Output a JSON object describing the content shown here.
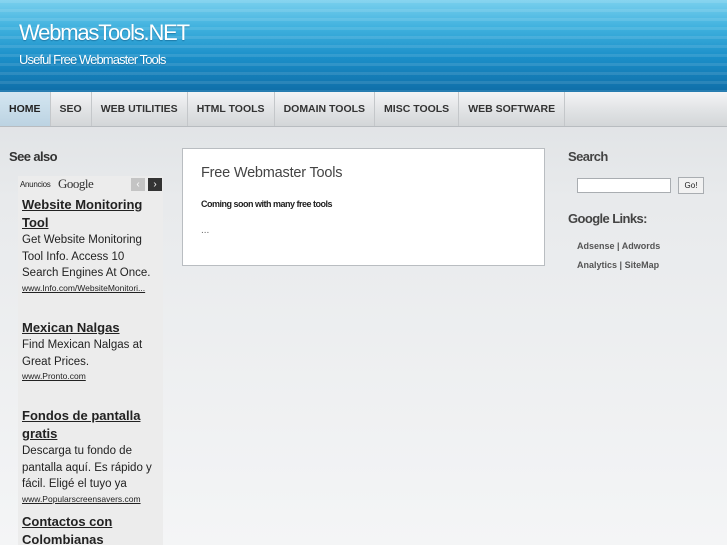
{
  "header": {
    "title": "WebmasTools.NET",
    "tagline": "Useful Free Webmaster Tools"
  },
  "nav": {
    "items": [
      {
        "label": "HOME"
      },
      {
        "label": "SEO"
      },
      {
        "label": "WEB UTILITIES"
      },
      {
        "label": "HTML TOOLS"
      },
      {
        "label": "DOMAIN TOOLS"
      },
      {
        "label": "MISC TOOLS"
      },
      {
        "label": "WEB SOFTWARE"
      }
    ],
    "active": "HOME"
  },
  "left": {
    "heading": "See also",
    "ads": {
      "anuncios_label": "Anuncios",
      "google_label": "Google",
      "prev_icon": "‹",
      "next_icon": "›",
      "items": [
        {
          "title": "Website Monitoring Tool",
          "desc": "Get Website Monitoring Tool Info. Access 10 Search Engines At Once.",
          "url": "www.Info.com/WebsiteMonitori..."
        },
        {
          "title": "Mexican Nalgas",
          "desc": "Find Mexican Nalgas at Great Prices.",
          "url": "www.Pronto.com"
        },
        {
          "title": "Fondos de pantalla gratis",
          "desc": "Descarga tu fondo de pantalla aquí. Es rápido y fácil. Eligé el tuyo ya",
          "url": "www.Popularscreensavers.com"
        },
        {
          "title": "Contactos con Colombianas",
          "desc": "",
          "url": ""
        }
      ]
    }
  },
  "center": {
    "title": "Free Webmaster Tools",
    "subtitle": "Coming soon with many free tools",
    "ellipsis": "..."
  },
  "right": {
    "search_heading": "Search",
    "search_value": "",
    "search_button": "Go!",
    "links_heading": "Google Links:",
    "links": [
      {
        "a": "Adsense",
        "sep": "|",
        "b": "Adwords"
      },
      {
        "a": "Analytics",
        "sep": "|",
        "b": "SiteMap"
      }
    ]
  },
  "colors": {
    "header_top": "#7ad0ee",
    "header_bottom": "#0f6ea8",
    "active_tab": "#c8dce9"
  }
}
